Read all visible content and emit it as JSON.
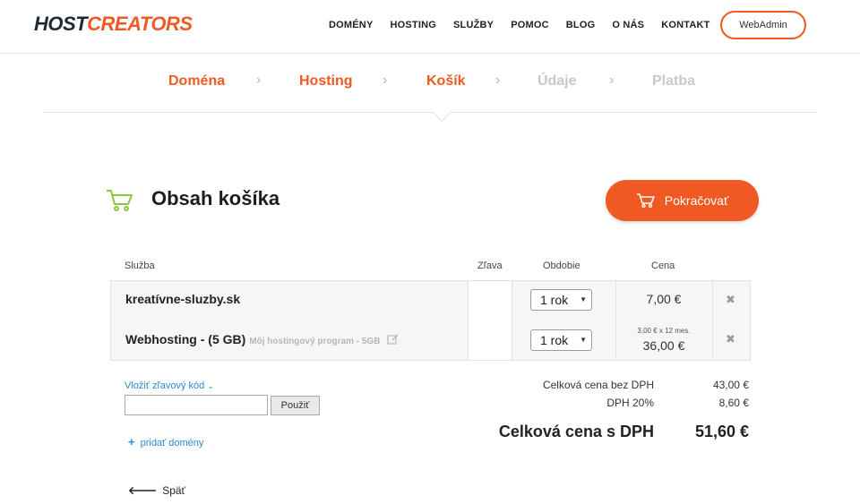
{
  "header": {
    "logo_host": "HOST",
    "logo_creators": "CREATORS",
    "nav": [
      "DOMÉNY",
      "HOSTING",
      "SLUŽBY",
      "POMOC",
      "BLOG",
      "O NÁS",
      "KONTAKT"
    ],
    "webadmin_label": "WebAdmin"
  },
  "steps": [
    "Doména",
    "Hosting",
    "Košík",
    "Údaje",
    "Platba"
  ],
  "cart": {
    "title": "Obsah košíka",
    "continue_label": "Pokračovať",
    "columns": {
      "service": "Služba",
      "discount": "Zľava",
      "period": "Obdobie",
      "price": "Cena"
    },
    "items": [
      {
        "name": "kreatívne-sluzby.sk",
        "note": "",
        "period": "1 rok",
        "price_detail": "",
        "price": "7,00 €"
      },
      {
        "name": "Webhosting - (5 GB)",
        "note": "Môj hostingový program - 5GB",
        "period": "1 rok",
        "price_detail": "3,00 € x 12 mes.",
        "price": "36,00 €"
      }
    ]
  },
  "discount": {
    "link_label": "Vložiť zľavový kód",
    "input_value": "",
    "apply_label": "Použiť"
  },
  "add_domain_label": "pridať domény",
  "totals": {
    "without_vat_label": "Celková cena bez DPH",
    "without_vat_value": "43,00 €",
    "vat_label": "DPH 20%",
    "vat_value": "8,60 €",
    "with_vat_label": "Celková cena s DPH",
    "with_vat_value": "51,60 €"
  },
  "back_label": "Späť",
  "colors": {
    "accent": "#f05a22",
    "dark": "#1d2836",
    "link": "#2a8bd0",
    "cart_icon": "#8cc63f"
  }
}
